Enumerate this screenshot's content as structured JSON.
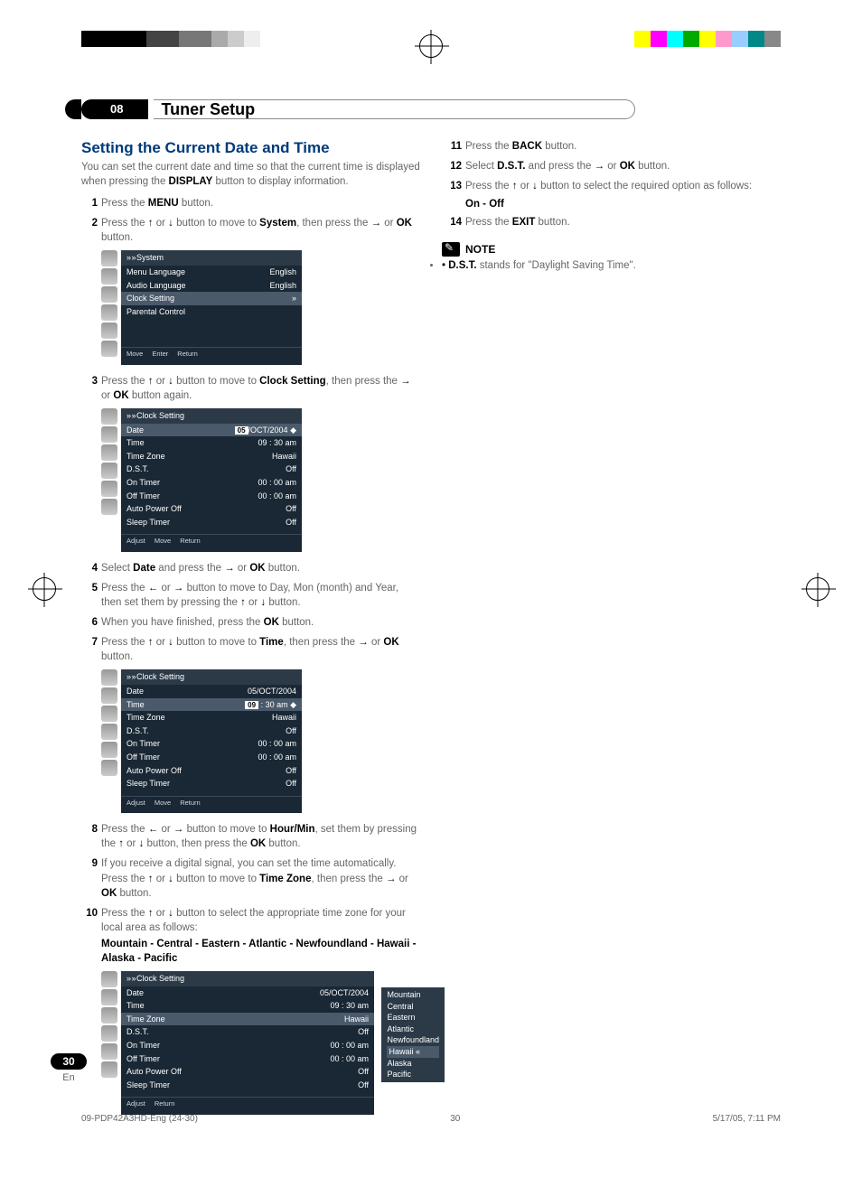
{
  "chapter": {
    "number": "08",
    "title": "Tuner Setup"
  },
  "section": {
    "title": "Setting the Current Date and Time",
    "intro_pre": "You can set the current date and time so that the current time is displayed when pressing the ",
    "intro_kw": "DISPLAY",
    "intro_post": " button to display information."
  },
  "steps_left": {
    "s1_pre": "Press the ",
    "s1_kw": "MENU",
    "s1_post": " button.",
    "s2_pre": "Press the ",
    "s2_mid": " button to move to ",
    "s2_kw": "System",
    "s2_post": ", then press the ",
    "s2_or": " or ",
    "s2_kw2": "OK",
    "s2_end": " button.",
    "s3_pre": "Press the ",
    "s3_mid": " button to move to ",
    "s3_kw": "Clock Setting",
    "s3_post": ", then press the ",
    "s3_or": " or ",
    "s3_kw2": "OK",
    "s3_end": " button again.",
    "s4_pre": "Select ",
    "s4_kw": "Date",
    "s4_mid": " and press the ",
    "s4_or": " or ",
    "s4_kw2": "OK",
    "s4_end": " button.",
    "s5_pre": "Press the ",
    "s5_mid": " button to move to Day, Mon (month) and Year, then set them by pressing the ",
    "s5_end": " button.",
    "s6_pre": "When you have finished, press the ",
    "s6_kw": "OK",
    "s6_end": " button.",
    "s7_pre": "Press the ",
    "s7_mid": " button to move to ",
    "s7_kw": "Time",
    "s7_post": ", then press the ",
    "s7_or": " or ",
    "s7_kw2": "OK",
    "s7_end": " button.",
    "s8_pre": "Press the ",
    "s8_mid": " button to move to ",
    "s8_kw": "Hour/Min",
    "s8_post": ", set them by pressing the ",
    "s8_mid2": " button, then press the ",
    "s8_kw2": "OK",
    "s8_end": " button.",
    "s9_pre": "If you receive a digital signal, you can set the time automatically. Press the ",
    "s9_mid": " button to move to ",
    "s9_kw": "Time Zone",
    "s9_post": ", then press the ",
    "s9_or": " or ",
    "s9_kw2": "OK",
    "s9_end": " button.",
    "s10_pre": "Press the ",
    "s10_mid": " button to select the appropriate time zone for your local area as follows:",
    "s10_list": "Mountain - Central - Eastern - Atlantic - Newfoundland - Hawaii - Alaska - Pacific"
  },
  "steps_right": {
    "s11_n": "11",
    "s11_pre": "Press the ",
    "s11_kw": "BACK",
    "s11_end": " button.",
    "s12_n": "12",
    "s12_pre": "Select ",
    "s12_kw": "D.S.T.",
    "s12_mid": " and press the ",
    "s12_or": " or ",
    "s12_kw2": "OK",
    "s12_end": " button.",
    "s13_n": "13",
    "s13_pre": "Press the ",
    "s13_mid": " button to select the required option as follows:",
    "s13_opts": "On - Off",
    "s14_n": "14",
    "s14_pre": "Press the ",
    "s14_kw": "EXIT",
    "s14_end": " button."
  },
  "note": {
    "label": "NOTE",
    "kw": "D.S.T.",
    "text": " stands for \"Daylight Saving Time\"."
  },
  "osd_system": {
    "title": "System",
    "rows": [
      {
        "l": "Menu Language",
        "r": "English"
      },
      {
        "l": "Audio Language",
        "r": "English"
      },
      {
        "l": "Clock Setting",
        "r": "»",
        "hl": true
      },
      {
        "l": "Parental Control",
        "r": ""
      }
    ],
    "footer": [
      "Move",
      "Enter",
      "Return"
    ]
  },
  "osd_clock1": {
    "title": "Clock Setting",
    "rows": [
      {
        "l": "Date",
        "r": "05/OCT/2004",
        "dp": "05",
        "hl": true
      },
      {
        "l": "Time",
        "r": "09 : 30 am"
      },
      {
        "l": "Time Zone",
        "r": "Hawaii"
      },
      {
        "l": "D.S.T.",
        "r": "Off"
      },
      {
        "l": "On Timer",
        "r": "00 : 00 am"
      },
      {
        "l": "Off Timer",
        "r": "00 : 00 am"
      },
      {
        "l": "Auto Power Off",
        "r": "Off"
      },
      {
        "l": "Sleep Timer",
        "r": "Off"
      }
    ],
    "footer": [
      "Adjust",
      "Move",
      "Return"
    ]
  },
  "osd_clock2": {
    "title": "Clock Setting",
    "rows": [
      {
        "l": "Date",
        "r": "05/OCT/2004"
      },
      {
        "l": "Time",
        "r": "09 : 30 am",
        "dp": "09",
        "hl": true
      },
      {
        "l": "Time Zone",
        "r": "Hawaii"
      },
      {
        "l": "D.S.T.",
        "r": "Off"
      },
      {
        "l": "On Timer",
        "r": "00 : 00 am"
      },
      {
        "l": "Off Timer",
        "r": "00 : 00 am"
      },
      {
        "l": "Auto Power Off",
        "r": "Off"
      },
      {
        "l": "Sleep Timer",
        "r": "Off"
      }
    ],
    "footer": [
      "Adjust",
      "Move",
      "Return"
    ]
  },
  "osd_clock3": {
    "title": "Clock Setting",
    "rows": [
      {
        "l": "Date",
        "r": "05/OCT/2004"
      },
      {
        "l": "Time",
        "r": "09 : 30 am"
      },
      {
        "l": "Time Zone",
        "r": "Hawaii",
        "hl": true
      },
      {
        "l": "D.S.T.",
        "r": "Off"
      },
      {
        "l": "On Timer",
        "r": "00 : 00 am"
      },
      {
        "l": "Off Timer",
        "r": "00 : 00 am"
      },
      {
        "l": "Auto Power Off",
        "r": "Off"
      },
      {
        "l": "Sleep Timer",
        "r": "Off"
      }
    ],
    "footer": [
      "Adjust",
      "Return"
    ],
    "popup": [
      "Mountain",
      "Central",
      "Eastern",
      "Atlantic",
      "Newfoundland",
      "Hawaii",
      "Alaska",
      "Pacific"
    ],
    "popup_sel": "Hawaii"
  },
  "page": {
    "number": "30",
    "lang": "En"
  },
  "doc_footer": {
    "file": "09-PDP42A3HD-Eng (24-30)",
    "page": "30",
    "timestamp": "5/17/05, 7:11 PM"
  }
}
